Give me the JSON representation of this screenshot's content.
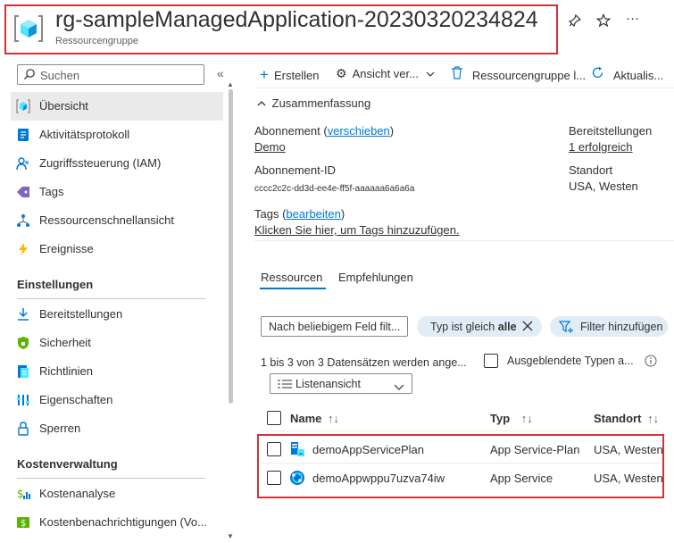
{
  "header": {
    "title": "rg-sampleManagedApplication-20230320234824",
    "subtitle": "Ressourcengruppe",
    "pin_icon": "pin-icon",
    "star_icon": "star-icon",
    "more_label": "···"
  },
  "sidebar": {
    "search_placeholder": "Suchen",
    "collapse_label": "«",
    "items_top": [
      {
        "label": "Übersicht",
        "icon": "resource-group-icon",
        "selected": true
      },
      {
        "label": "Aktivitätsprotokoll",
        "icon": "log-icon"
      },
      {
        "label": "Zugriffssteuerung (IAM)",
        "icon": "iam-icon"
      },
      {
        "label": "Tags",
        "icon": "tag-icon"
      },
      {
        "label": "Ressourcenschnellansicht",
        "icon": "visualizer-icon"
      },
      {
        "label": "Ereignisse",
        "icon": "lightning-icon"
      }
    ],
    "section_settings": "Einstellungen",
    "items_settings": [
      {
        "label": "Bereitstellungen",
        "icon": "deployments-icon"
      },
      {
        "label": "Sicherheit",
        "icon": "shield-icon"
      },
      {
        "label": "Richtlinien",
        "icon": "policy-icon"
      },
      {
        "label": "Eigenschaften",
        "icon": "properties-icon"
      },
      {
        "label": "Sperren",
        "icon": "lock-icon"
      }
    ],
    "section_cost": "Kostenverwaltung",
    "items_cost": [
      {
        "label": "Kostenanalyse",
        "icon": "cost-analysis-icon"
      },
      {
        "label": "Kostenbenachrichtigungen (Vo...",
        "icon": "cost-alerts-icon"
      }
    ]
  },
  "toolbar": {
    "create": "Erstellen",
    "view": "Ansicht ver...",
    "delete": "Ressourcengruppe l...",
    "refresh": "Aktualis..."
  },
  "essentials": {
    "toggle": "Zusammenfassung",
    "subscription_label": "Abonnement",
    "subscription_move": "verschieben",
    "subscription_value": "Demo",
    "subscription_id_label": "Abonnement-ID",
    "subscription_id_value": "cccc2c2c-dd3d-ee4e-ff5f-aaaaaa6a6a6a",
    "tags_label": "Tags",
    "tags_edit": "bearbeiten",
    "tags_add": "Klicken Sie hier, um Tags hinzuzufügen.",
    "deployments_label": "Bereitstellungen",
    "deployments_value": "1 erfolgreich",
    "location_label": "Standort",
    "location_value": "USA, Westen"
  },
  "tabs": {
    "resources": "Ressourcen",
    "recommendations": "Empfehlungen"
  },
  "filters": {
    "filter_placeholder": "Nach beliebigem Feld filt...",
    "type_filter_prefix": "Typ ist gleich",
    "type_filter_value": "alle",
    "add_filter": "Filter hinzufügen",
    "records": "1 bis 3 von 3 Datensätzen werden ange...",
    "hidden_types": "Ausgeblendete Typen a...",
    "list_view": "Listenansicht"
  },
  "table": {
    "col_name": "Name",
    "col_type": "Typ",
    "col_location": "Standort",
    "rows": [
      {
        "name": "demoAppServicePlan",
        "type": "App Service-Plan",
        "location": "USA, Westen",
        "icon": "app-service-plan-icon"
      },
      {
        "name": "demoAppwppu7uzva74iw",
        "type": "App Service",
        "location": "USA, Westen",
        "icon": "app-service-icon"
      }
    ]
  },
  "colors": {
    "accent": "#0078d4",
    "highlight_border": "#d13438"
  }
}
